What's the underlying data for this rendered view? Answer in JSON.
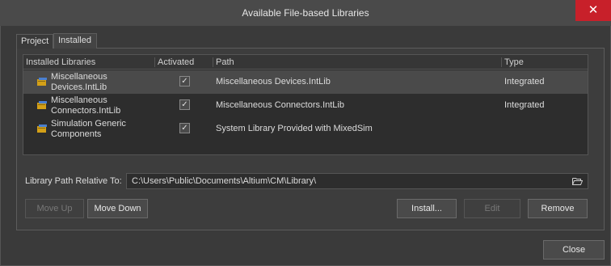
{
  "window": {
    "title": "Available File-based Libraries",
    "close_glyph": "✕"
  },
  "tabs": [
    {
      "label": "Project",
      "active": false
    },
    {
      "label": "Installed",
      "active": true
    }
  ],
  "table": {
    "columns": [
      "Installed Libraries",
      "Activated",
      "Path",
      "Type"
    ],
    "rows": [
      {
        "name_line1": "Miscellaneous",
        "name_line2": "Devices.IntLib",
        "activated": true,
        "path": "Miscellaneous Devices.IntLib",
        "type": "Integrated",
        "selected": true
      },
      {
        "name_line1": "Miscellaneous",
        "name_line2": "Connectors.IntLib",
        "activated": true,
        "path": "Miscellaneous Connectors.IntLib",
        "type": "Integrated",
        "selected": false
      },
      {
        "name_line1": "Simulation Generic",
        "name_line2": "Components",
        "activated": true,
        "path": "System Library Provided with MixedSim",
        "type": "",
        "selected": false
      }
    ]
  },
  "library_path": {
    "label": "Library Path Relative To:",
    "value": "C:\\Users\\Public\\Documents\\Altium\\CM\\Library\\"
  },
  "buttons": {
    "move_up": "Move Up",
    "move_down": "Move Down",
    "install": "Install...",
    "edit": "Edit",
    "remove": "Remove",
    "close": "Close"
  },
  "colors": {
    "accent_close": "#c8202a",
    "selected_row": "#4a4a4a"
  },
  "icons": {
    "library": "library-icon",
    "folder": "folder-open-icon",
    "check": "✓"
  }
}
